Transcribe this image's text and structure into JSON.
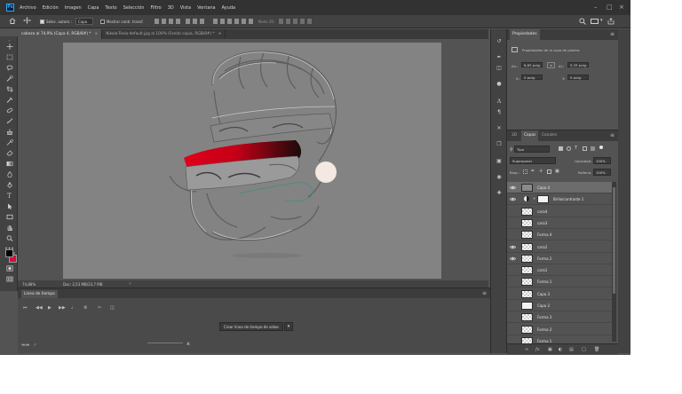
{
  "menubar": {
    "app_icon": "Ps",
    "items": [
      "Archivo",
      "Edición",
      "Imagen",
      "Capa",
      "Texto",
      "Selección",
      "Filtro",
      "3D",
      "Vista",
      "Ventana",
      "Ayuda"
    ],
    "window_controls": [
      "minimize-icon",
      "maximize-icon",
      "close-icon"
    ]
  },
  "optionsbar": {
    "autoselect_label": "Selec. autom.:",
    "autoselect_value": "Capa",
    "show_transform_label": "Mostrar contr. transf.",
    "mode_3d_label": "Modo 3D:"
  },
  "doc_tabs": [
    {
      "label": "cabeza al 74,9% (Capa 4, RGB/8#) *",
      "active": true
    },
    {
      "label": "Nikola-Tesla-default.jpg al 100% (Fondo copia, RGB/8#) *",
      "active": false
    }
  ],
  "statusbar": {
    "zoom": "74,88%",
    "doc": "Doc: 2,53 MB/23,7 MB"
  },
  "timeline": {
    "tab_label": "Línea de tiempo",
    "create_button": "Crear línea de tiempo de vídeo"
  },
  "properties": {
    "tab_label": "Propiedades",
    "subtitle": "Propiedades de la capa de píxeles",
    "an_label": "An.:",
    "an_value": "6,83 pulg.",
    "al_label": "Al.:",
    "al_value": "5,33 pulg.",
    "x_label": "X:",
    "x_value": "0 pulg.",
    "y_label": "Y:",
    "y_value": "0 pulg."
  },
  "layers": {
    "tabs": [
      "3D",
      "Capas",
      "Canales"
    ],
    "active_tab": "Capas",
    "filter_value": "Tipo",
    "blend_mode": "Superponer",
    "opacity_label": "Opacidad:",
    "opacity_value": "100%",
    "lock_label": "Bloq.:",
    "fill_label": "Relleno:",
    "fill_value": "100%",
    "items": [
      {
        "name": "Capa 4",
        "visible": true,
        "selected": true,
        "thumb": "mid"
      },
      {
        "name": "Brillo/contraste 1",
        "visible": true,
        "selected": false,
        "thumb": "adjust"
      },
      {
        "name": "cara4",
        "visible": false,
        "selected": false,
        "thumb": "checker"
      },
      {
        "name": "cara3",
        "visible": false,
        "selected": false,
        "thumb": "checker"
      },
      {
        "name": "Forma 4",
        "visible": false,
        "selected": false,
        "thumb": "checker"
      },
      {
        "name": "cara2",
        "visible": true,
        "selected": false,
        "thumb": "checker"
      },
      {
        "name": "Forma 2",
        "visible": true,
        "selected": false,
        "thumb": "checker"
      },
      {
        "name": "cara1",
        "visible": false,
        "selected": false,
        "thumb": "checker"
      },
      {
        "name": "Forma 1",
        "visible": false,
        "selected": false,
        "thumb": "checker"
      },
      {
        "name": "Capa 3",
        "visible": false,
        "selected": false,
        "thumb": "checker"
      },
      {
        "name": "Capa 2",
        "visible": false,
        "selected": false,
        "thumb": "solid"
      },
      {
        "name": "Forma 3",
        "visible": false,
        "selected": false,
        "thumb": "checker"
      },
      {
        "name": "Forma 2",
        "visible": false,
        "selected": false,
        "thumb": "checker"
      },
      {
        "name": "Forma 1",
        "visible": false,
        "selected": false,
        "thumb": "checker"
      }
    ]
  },
  "colors": {
    "foreground": "#000000",
    "background": "#d40d3a",
    "accent_red": "#e0001a"
  }
}
